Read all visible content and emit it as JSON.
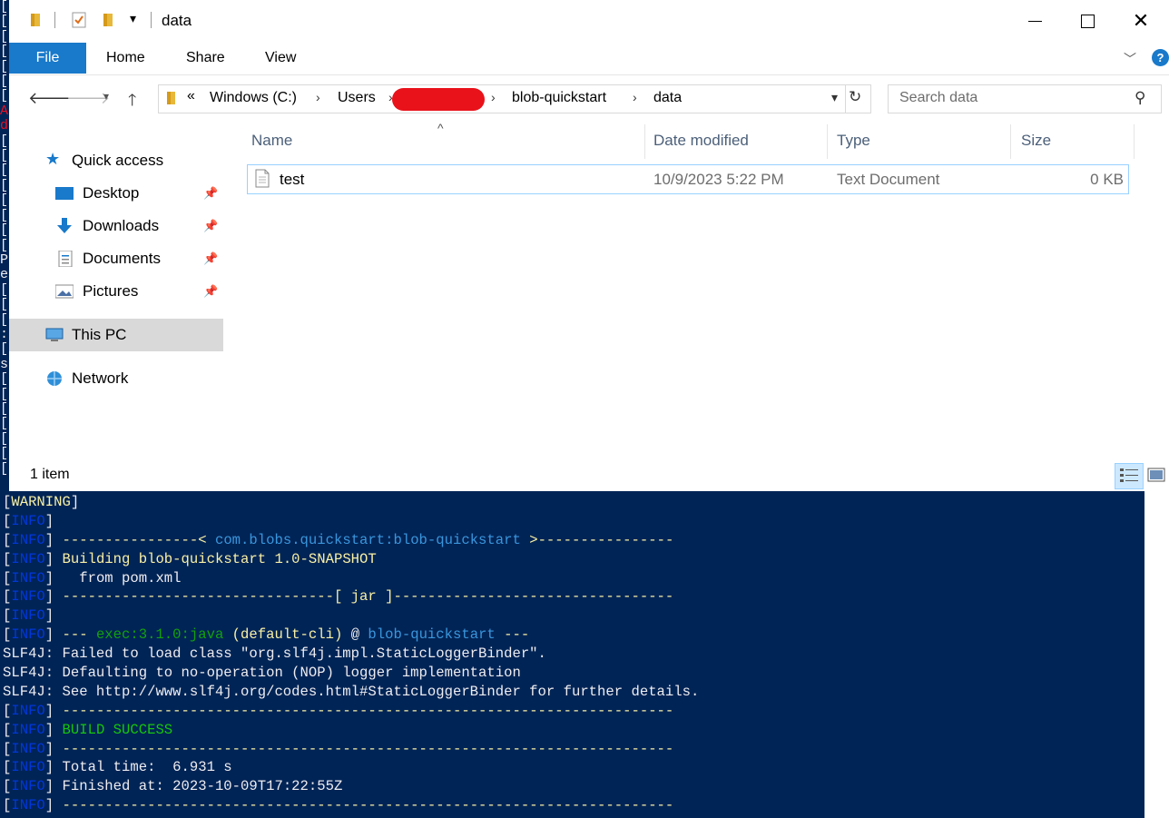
{
  "window": {
    "title": "data",
    "tabs": [
      "File",
      "Home",
      "Share",
      "View"
    ],
    "help": "?"
  },
  "address": {
    "prefix": "«",
    "crumbs": [
      "Windows (C:)",
      "Users",
      "blob-quickstart",
      "data"
    ],
    "search_placeholder": "Search data"
  },
  "nav": {
    "quick_access": "Quick access",
    "items": [
      "Desktop",
      "Downloads",
      "Documents",
      "Pictures"
    ],
    "this_pc": "This PC",
    "network": "Network"
  },
  "columns": [
    "Name",
    "Date modified",
    "Type",
    "Size"
  ],
  "files": [
    {
      "name": "test",
      "date": "10/9/2023 5:22 PM",
      "type": "Text Document",
      "size": "0 KB"
    }
  ],
  "status": "1 item",
  "terminal": {
    "left_chars": [
      "[",
      "[",
      "[",
      "[",
      "[",
      "[",
      "[",
      "A",
      "d",
      "[",
      "[",
      "[",
      "[",
      "[",
      "[",
      "[",
      "[",
      "P",
      "e",
      "[",
      "[",
      "[",
      ":",
      "[",
      "s",
      "[",
      "[",
      "[",
      "[",
      "[",
      "[",
      "["
    ],
    "lines": [
      [
        {
          "t": "[",
          "c": ""
        },
        {
          "t": "WARNING",
          "c": "wy"
        },
        {
          "t": "]",
          "c": ""
        }
      ],
      [
        {
          "t": "[",
          "c": ""
        },
        {
          "t": "INFO",
          "c": "b"
        },
        {
          "t": "]",
          "c": ""
        }
      ],
      [
        {
          "t": "[",
          "c": ""
        },
        {
          "t": "INFO",
          "c": "b"
        },
        {
          "t": "] ",
          "c": ""
        },
        {
          "t": "----------------< ",
          "c": "y"
        },
        {
          "t": "com.blobs.quickstart:blob-quickstart",
          "c": "teal"
        },
        {
          "t": " >----------------",
          "c": "y"
        }
      ],
      [
        {
          "t": "[",
          "c": ""
        },
        {
          "t": "INFO",
          "c": "b"
        },
        {
          "t": "] ",
          "c": ""
        },
        {
          "t": "Building blob-quickstart 1.0-SNAPSHOT",
          "c": "y"
        }
      ],
      [
        {
          "t": "[",
          "c": ""
        },
        {
          "t": "INFO",
          "c": "b"
        },
        {
          "t": "]   from pom.xml",
          "c": ""
        }
      ],
      [
        {
          "t": "[",
          "c": ""
        },
        {
          "t": "INFO",
          "c": "b"
        },
        {
          "t": "] ",
          "c": ""
        },
        {
          "t": "--------------------------------[ jar ]---------------------------------",
          "c": "y"
        }
      ],
      [
        {
          "t": "[",
          "c": ""
        },
        {
          "t": "INFO",
          "c": "b"
        },
        {
          "t": "]",
          "c": ""
        }
      ],
      [
        {
          "t": "[",
          "c": ""
        },
        {
          "t": "INFO",
          "c": "b"
        },
        {
          "t": "] ",
          "c": ""
        },
        {
          "t": "--- ",
          "c": "y"
        },
        {
          "t": "exec:3.1.0:java",
          "c": "dim"
        },
        {
          "t": " (default-cli)",
          "c": "y"
        },
        {
          "t": " @ ",
          "c": ""
        },
        {
          "t": "blob-quickstart",
          "c": "teal"
        },
        {
          "t": " ---",
          "c": "y"
        }
      ],
      [
        {
          "t": "SLF4J: Failed to load class \"org.slf4j.impl.StaticLoggerBinder\".",
          "c": ""
        }
      ],
      [
        {
          "t": "SLF4J: Defaulting to no-operation (NOP) logger implementation",
          "c": ""
        }
      ],
      [
        {
          "t": "SLF4J: See http://www.slf4j.org/codes.html#StaticLoggerBinder for further details.",
          "c": ""
        }
      ],
      [
        {
          "t": "[",
          "c": ""
        },
        {
          "t": "INFO",
          "c": "b"
        },
        {
          "t": "] ",
          "c": ""
        },
        {
          "t": "------------------------------------------------------------------------",
          "c": "y"
        }
      ],
      [
        {
          "t": "[",
          "c": ""
        },
        {
          "t": "INFO",
          "c": "b"
        },
        {
          "t": "] ",
          "c": ""
        },
        {
          "t": "BUILD SUCCESS",
          "c": "bright"
        }
      ],
      [
        {
          "t": "[",
          "c": ""
        },
        {
          "t": "INFO",
          "c": "b"
        },
        {
          "t": "] ",
          "c": ""
        },
        {
          "t": "------------------------------------------------------------------------",
          "c": "y"
        }
      ],
      [
        {
          "t": "[",
          "c": ""
        },
        {
          "t": "INFO",
          "c": "b"
        },
        {
          "t": "] Total time:  6.931 s",
          "c": ""
        }
      ],
      [
        {
          "t": "[",
          "c": ""
        },
        {
          "t": "INFO",
          "c": "b"
        },
        {
          "t": "] Finished at: 2023-10-09T17:22:55Z",
          "c": ""
        }
      ],
      [
        {
          "t": "[",
          "c": ""
        },
        {
          "t": "INFO",
          "c": "b"
        },
        {
          "t": "] ",
          "c": ""
        },
        {
          "t": "------------------------------------------------------------------------",
          "c": "y"
        }
      ]
    ]
  }
}
